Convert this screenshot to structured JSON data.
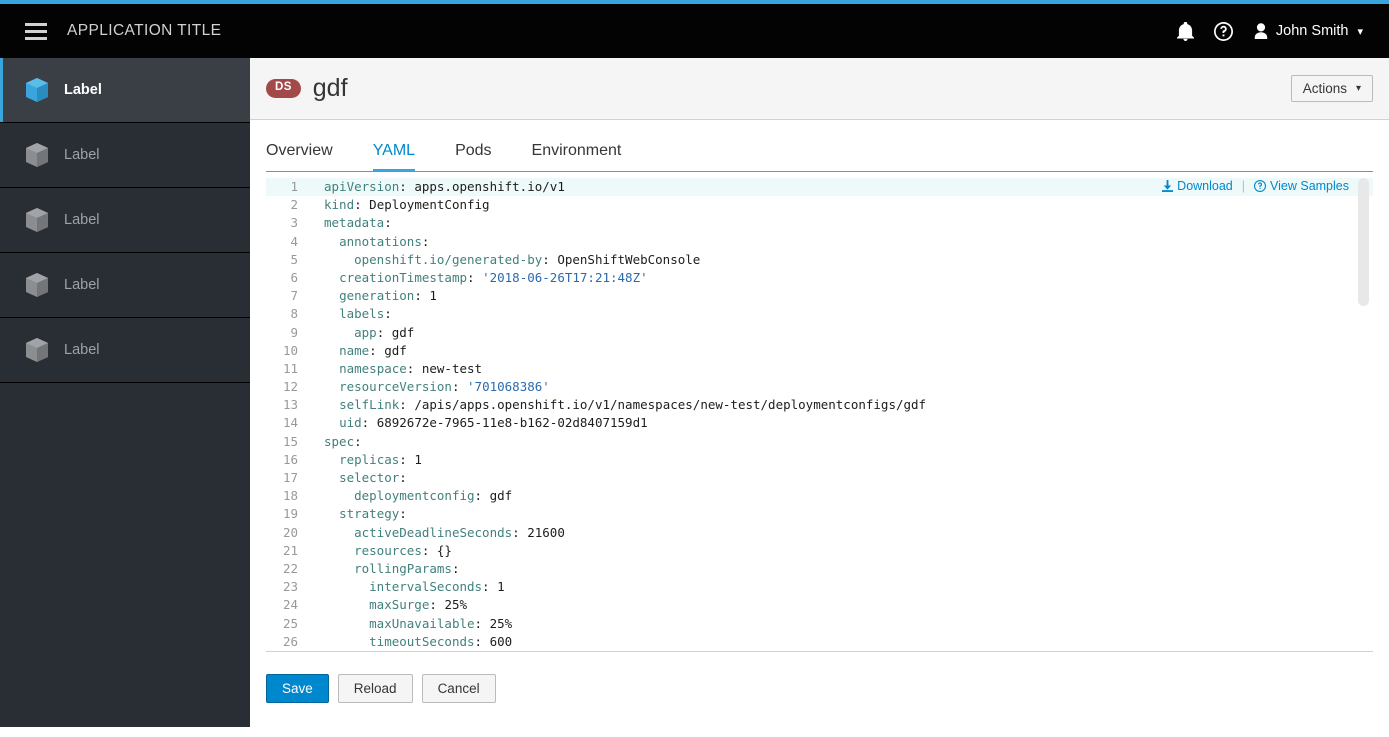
{
  "masthead": {
    "menu_icon": "hamburger-icon",
    "app_title": "APPLICATION TITLE",
    "notifications_icon": "bell-icon",
    "help_icon": "help-circle-icon",
    "user_icon": "user-avatar-icon",
    "user_name": "John Smith",
    "user_caret": "⌄"
  },
  "sidebar": {
    "items": [
      {
        "label": "Label",
        "icon": "cube-icon",
        "active": true
      },
      {
        "label": "Label",
        "icon": "cube-icon",
        "active": false
      },
      {
        "label": "Label",
        "icon": "cube-icon",
        "active": false
      },
      {
        "label": "Label",
        "icon": "cube-icon",
        "active": false
      },
      {
        "label": "Label",
        "icon": "cube-icon",
        "active": false
      }
    ]
  },
  "page_header": {
    "badge": "DS",
    "badge_color": "#a24a4a",
    "title": "gdf",
    "actions_label": "Actions",
    "actions_caret": "⌄"
  },
  "tabs": [
    {
      "label": "Overview",
      "active": false
    },
    {
      "label": "YAML",
      "active": true
    },
    {
      "label": "Pods",
      "active": false
    },
    {
      "label": "Environment",
      "active": false
    }
  ],
  "editor": {
    "download_label": "Download",
    "download_icon": "download-icon",
    "separator": "|",
    "view_samples_label": "View Samples",
    "view_samples_icon": "help-circle-icon",
    "active_line": 1,
    "lines": [
      {
        "n": "1",
        "indent": 0,
        "key": "apiVersion",
        "value": "apps.openshift.io/v1",
        "type": "plain"
      },
      {
        "n": "2",
        "indent": 0,
        "key": "kind",
        "value": "DeploymentConfig",
        "type": "plain"
      },
      {
        "n": "3",
        "indent": 0,
        "key": "metadata",
        "value": "",
        "type": "none"
      },
      {
        "n": "4",
        "indent": 1,
        "key": "annotations",
        "value": "",
        "type": "none"
      },
      {
        "n": "5",
        "indent": 2,
        "key": "openshift.io/generated-by",
        "value": "OpenShiftWebConsole",
        "type": "plain"
      },
      {
        "n": "6",
        "indent": 1,
        "key": "creationTimestamp",
        "value": "'2018-06-26T17:21:48Z'",
        "type": "string"
      },
      {
        "n": "7",
        "indent": 1,
        "key": "generation",
        "value": "1",
        "type": "plain"
      },
      {
        "n": "8",
        "indent": 1,
        "key": "labels",
        "value": "",
        "type": "none"
      },
      {
        "n": "9",
        "indent": 2,
        "key": "app",
        "value": "gdf",
        "type": "plain"
      },
      {
        "n": "10",
        "indent": 1,
        "key": "name",
        "value": "gdf",
        "type": "plain"
      },
      {
        "n": "11",
        "indent": 1,
        "key": "namespace",
        "value": "new-test",
        "type": "plain"
      },
      {
        "n": "12",
        "indent": 1,
        "key": "resourceVersion",
        "value": "'701068386'",
        "type": "string"
      },
      {
        "n": "13",
        "indent": 1,
        "key": "selfLink",
        "value": "/apis/apps.openshift.io/v1/namespaces/new-test/deploymentconfigs/gdf",
        "type": "plain"
      },
      {
        "n": "14",
        "indent": 1,
        "key": "uid",
        "value": "6892672e-7965-11e8-b162-02d8407159d1",
        "type": "plain"
      },
      {
        "n": "15",
        "indent": 0,
        "key": "spec",
        "value": "",
        "type": "none"
      },
      {
        "n": "16",
        "indent": 1,
        "key": "replicas",
        "value": "1",
        "type": "plain"
      },
      {
        "n": "17",
        "indent": 1,
        "key": "selector",
        "value": "",
        "type": "none"
      },
      {
        "n": "18",
        "indent": 2,
        "key": "deploymentconfig",
        "value": "gdf",
        "type": "plain"
      },
      {
        "n": "19",
        "indent": 1,
        "key": "strategy",
        "value": "",
        "type": "none"
      },
      {
        "n": "20",
        "indent": 2,
        "key": "activeDeadlineSeconds",
        "value": "21600",
        "type": "plain"
      },
      {
        "n": "21",
        "indent": 2,
        "key": "resources",
        "value": "{}",
        "type": "plain"
      },
      {
        "n": "22",
        "indent": 2,
        "key": "rollingParams",
        "value": "",
        "type": "none"
      },
      {
        "n": "23",
        "indent": 3,
        "key": "intervalSeconds",
        "value": "1",
        "type": "plain"
      },
      {
        "n": "24",
        "indent": 3,
        "key": "maxSurge",
        "value": "25%",
        "type": "plain"
      },
      {
        "n": "25",
        "indent": 3,
        "key": "maxUnavailable",
        "value": "25%",
        "type": "plain"
      },
      {
        "n": "26",
        "indent": 3,
        "key": "timeoutSeconds",
        "value": "600",
        "type": "plain"
      }
    ]
  },
  "footer_buttons": [
    {
      "label": "Save",
      "style": "primary"
    },
    {
      "label": "Reload",
      "style": "default"
    },
    {
      "label": "Cancel",
      "style": "default"
    }
  ]
}
